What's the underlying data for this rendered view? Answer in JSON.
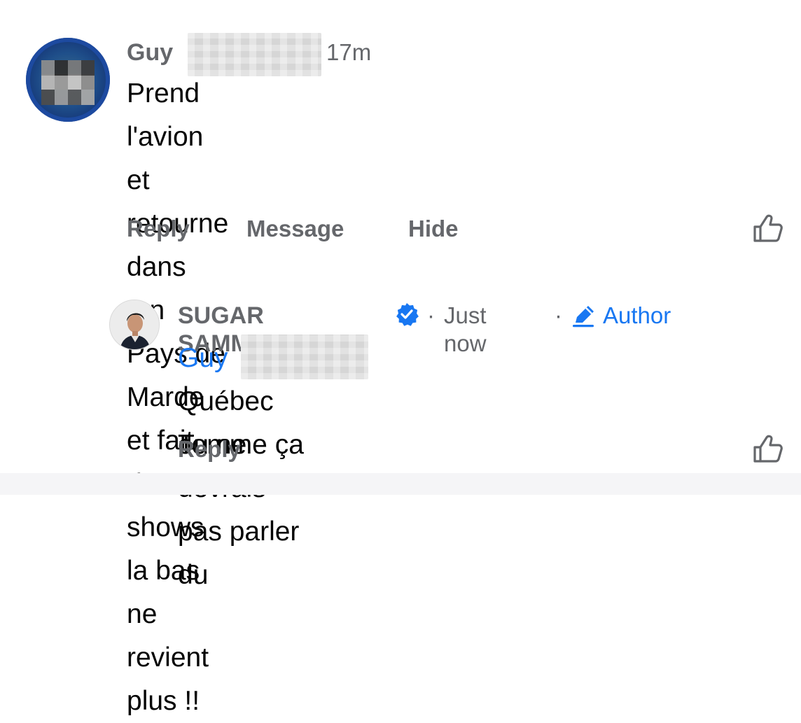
{
  "comment1": {
    "author": "Guy",
    "time": "17m",
    "text": "Prend l'avion et retourne dans ton Pays de Marde et fait des shows la bas ne revient plus !!",
    "line1": "Prend l'avion et retourne dans ton Pays de",
    "line2": "Marde et fait des shows la bas ne revient",
    "line3": "plus !!",
    "actions": {
      "reply": "Reply",
      "message": "Message",
      "hide": "Hide"
    }
  },
  "comment2": {
    "author": "SUGAR SAMMY",
    "separator1": "·",
    "time": "Just now",
    "separator2": "·",
    "author_badge": "Author",
    "mention": "Guy",
    "line1": "Tu ne devrais pas parler du",
    "line2": "Québec comme ça",
    "actions": {
      "reply": "Reply"
    }
  },
  "icons": {
    "like": "thumbs-up-icon",
    "verified": "verified-badge-icon",
    "pencil": "pencil-icon"
  },
  "colors": {
    "link_blue": "#1877f2",
    "secondary_text": "#65676b",
    "primary_text": "#050505"
  }
}
